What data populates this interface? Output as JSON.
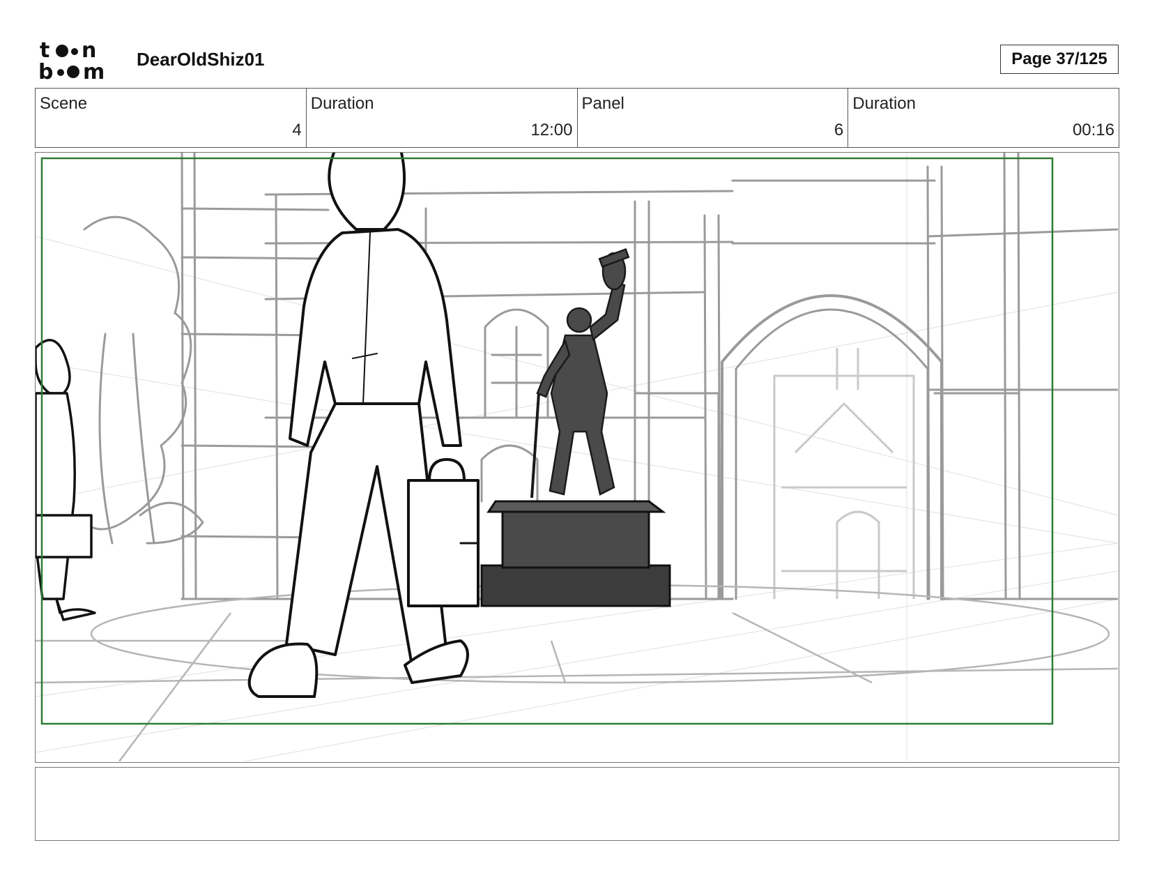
{
  "header": {
    "logo_text": "toon boom",
    "project_title": "DearOldShiz01",
    "page_label": "Page 37/125"
  },
  "info": [
    {
      "label": "Scene",
      "value": "4"
    },
    {
      "label": "Duration",
      "value": "12:00"
    },
    {
      "label": "Panel",
      "value": "6"
    },
    {
      "label": "Duration",
      "value": "00:16"
    }
  ],
  "panel": {
    "safe_frame_color": "#2e7d32",
    "sketch_color": "#9a9a9a",
    "ink_color": "#111111",
    "statue_color": "#4a4a4a"
  },
  "notes": {
    "text": ""
  }
}
